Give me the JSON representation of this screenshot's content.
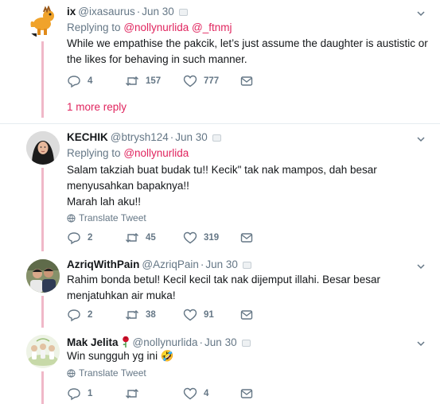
{
  "tweets": [
    {
      "name": "ix",
      "handle": "@ixasaurus",
      "date": "Jun 30",
      "replying_prefix": "Replying to",
      "replying_to": "@nollynurlida @_ftnmj",
      "body": "While we empathise the pakcik, let’s just assume the daughter is austistic or the likes for behaving in such manner.",
      "reply_count": "4",
      "retweet_count": "157",
      "like_count": "777",
      "more_replies": "1 more reply"
    },
    {
      "name": "KECHIK",
      "handle": "@btrysh124",
      "date": "Jun 30",
      "replying_prefix": "Replying to",
      "replying_to": "@nollynurlida",
      "body_lines": [
        "Salam takziah buat budak tu!! Kecik\" tak nak mampos, dah besar menyusahkan bapaknya!!",
        "Marah lah aku!!"
      ],
      "translate": "Translate Tweet",
      "reply_count": "2",
      "retweet_count": "45",
      "like_count": "319"
    },
    {
      "name": "AzriqWithPain",
      "handle": "@AzriqPain",
      "date": "Jun 30",
      "body": "Rahim bonda betul! Kecil kecil tak nak dijemput illahi. Besar besar menjatuhkan air muka!",
      "reply_count": "2",
      "retweet_count": "38",
      "like_count": "91"
    },
    {
      "name": "Mak Jelita",
      "handle": "@nollynurlida",
      "date": "Jun 30",
      "body": "Win sungguh yg ini 🤣",
      "translate": "Translate Tweet",
      "reply_count": "1",
      "retweet_count": "",
      "like_count": "4"
    }
  ],
  "icons": {
    "reply": "reply-icon",
    "retweet": "retweet-icon",
    "like": "like-icon",
    "dm": "direct-message-icon",
    "chevron": "chevron-down-icon",
    "globe": "globe-icon"
  },
  "colors": {
    "accent": "#e0245e",
    "secondary_text": "#657786",
    "thread_line": "#f0b8c8",
    "divider": "#e6ecf0"
  }
}
